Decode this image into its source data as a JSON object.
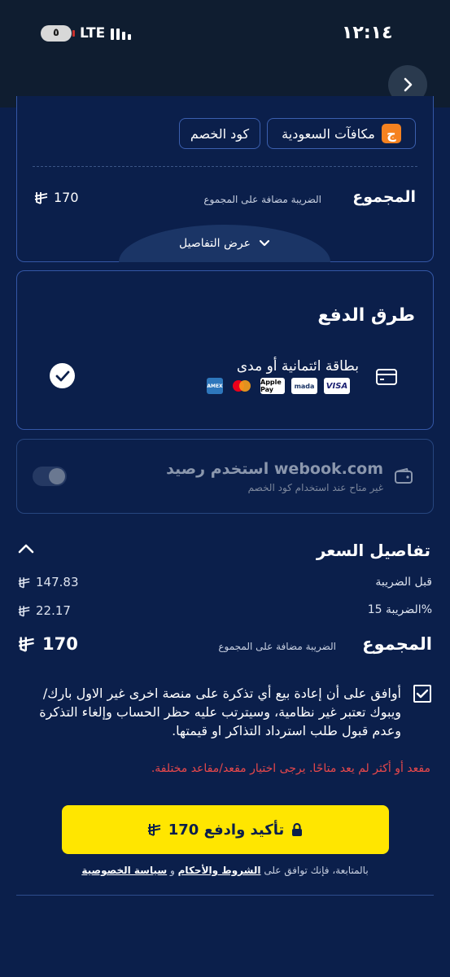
{
  "status_bar": {
    "notification_count": "٥",
    "network": "LTE",
    "time": "١٢:١٤"
  },
  "summary": {
    "chip_rewards": "مكافآت السعودية",
    "chip_rewards_logo": "ج",
    "chip_discount": "كود الخصم",
    "total_label": "المجموع",
    "total_sub": "الضريبة مضافة على المجموع",
    "total_value": "170",
    "details_toggle": "عرض التفاصيل"
  },
  "payment": {
    "title": "طرق الدفع",
    "option_label": "بطاقة ائتمانية أو مدى",
    "selected": true,
    "brands": [
      "AMEX",
      "mastercard",
      "Apple Pay",
      "mada",
      "VISA"
    ]
  },
  "wallet": {
    "title": "استخدم رصيد webook.com",
    "subtitle": "غير متاح عند استخدام كود الخصم",
    "enabled": false
  },
  "price_details": {
    "title": "تفاصيل السعر",
    "rows": [
      {
        "label": "قبل الضريبة",
        "value": "147.83"
      },
      {
        "label": "الضريبة 15%",
        "value": "22.17"
      }
    ],
    "total_label": "المجموع",
    "total_sub": "الضريبة مضافة على المجموع",
    "total_value": "170"
  },
  "agreement": {
    "checked": true,
    "text": "أوافق على أن إعادة بيع أي تذكرة على منصة اخرى غير الاول بارك/ ويبوك تعتبر غير نظامية، وسيترتب عليه حظر الحساب وإلغاء التذكرة وعدم قبول طلب استرداد التذاكر او قيمتها."
  },
  "error_message": "مقعد أو أكثر لم يعد متاحًا. يرجى اختيار مقعد/مقاعد مختلفة.",
  "confirm_button": {
    "label": "تأكيد وادفع 170"
  },
  "legal": {
    "prefix": "بالمتابعة، فإنك توافق على",
    "terms": "الشروط والأحكام",
    "and": "و",
    "privacy": "سياسة الخصوصية"
  },
  "colors": {
    "background": "#0b1f4b",
    "card_border": "#3457a6",
    "accent_yellow": "#ffe600",
    "error_red": "#e8484b"
  },
  "icons": [
    "chevron-right-icon",
    "chevron-down-icon",
    "chevron-up-icon",
    "credit-card-icon",
    "wallet-icon",
    "check-icon",
    "lock-icon",
    "riyal-icon"
  ]
}
